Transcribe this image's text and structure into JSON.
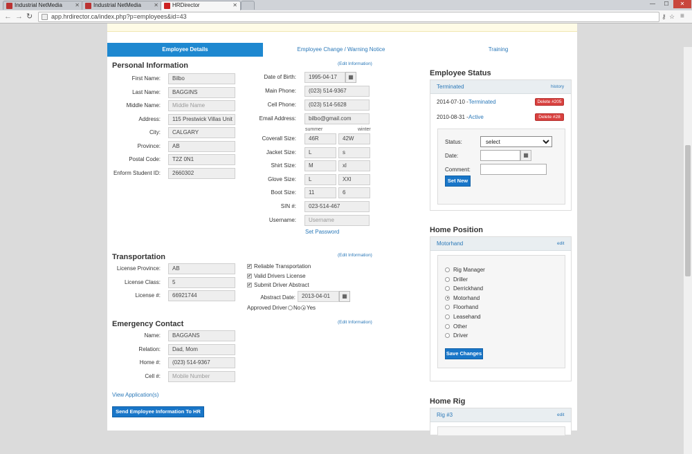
{
  "browser": {
    "tabs": [
      {
        "title": "Industrial NetMedia"
      },
      {
        "title": "Industrial NetMedia"
      },
      {
        "title": "HRDirector"
      }
    ],
    "url": "app.hrdirector.ca/index.php?p=employees&id=43"
  },
  "page_tabs": [
    "Employee Details",
    "Employee Change / Warning Notice",
    "Training"
  ],
  "personal": {
    "title": "Personal Information",
    "edit_link": "(Edit Information)",
    "fields": [
      {
        "label": "First Name:",
        "value": "Bilbo"
      },
      {
        "label": "Last Name:",
        "value": "BAGGINS"
      },
      {
        "label": "Middle Name:",
        "value": "Middle Name"
      },
      {
        "label": "Address:",
        "value": "115 Prestwick Villas Unit"
      },
      {
        "label": "City:",
        "value": "CALGARY"
      },
      {
        "label": "Province:",
        "value": "AB"
      },
      {
        "label": "Postal Code:",
        "value": "T2Z 0N1"
      },
      {
        "label": "Enform Student ID:",
        "value": "2660302"
      }
    ],
    "right_fields": [
      {
        "label": "Date of Birth:",
        "value": "1995-04-17"
      },
      {
        "label": "Main Phone:",
        "value": "(023) 514-9367"
      },
      {
        "label": "Cell Phone:",
        "value": "(023) 514-5628"
      },
      {
        "label": "Email Address:",
        "value": "bilbo@gmail.com"
      }
    ],
    "season_headers": [
      "summer",
      "winter"
    ],
    "sizes": [
      {
        "label": "Coverall Size:",
        "summer": "46R",
        "winter": "42W"
      },
      {
        "label": "Jacket Size:",
        "summer": "L",
        "winter": "s"
      },
      {
        "label": "Shirt Size:",
        "summer": "M",
        "winter": "xl"
      },
      {
        "label": "Glove Size:",
        "summer": "L",
        "winter": "XXl"
      },
      {
        "label": "Boot Size:",
        "summer": "11",
        "winter": "6"
      }
    ],
    "sin_label": "SIN #:",
    "sin_value": "023-514-467",
    "username_label": "Username:",
    "username_placeholder": "Username",
    "set_password": "Set Password"
  },
  "transportation": {
    "title": "Transportation",
    "edit_link": "(Edit Information)",
    "fields": [
      {
        "label": "License Province:",
        "value": "AB"
      },
      {
        "label": "License Class:",
        "value": "5"
      },
      {
        "label": "License #:",
        "value": "66921744"
      }
    ],
    "checks": [
      "Reliable Transportation",
      "Valid Drivers License",
      "Submit Driver Abstract"
    ],
    "abstract_label": "Abstract Date:",
    "abstract_value": "2013-04-01",
    "approved_label": "Approved Driver",
    "no_label": "No",
    "yes_label": "Yes"
  },
  "emergency": {
    "title": "Emergency Contact",
    "edit_link": "(Edit Information)",
    "fields": [
      {
        "label": "Name:",
        "value": "BAGGANS"
      },
      {
        "label": "Relation:",
        "value": "Dad, Mom"
      },
      {
        "label": "Home #:",
        "value": "(023) 514-9367"
      },
      {
        "label": "Cell #:",
        "value": "Mobile Number"
      }
    ]
  },
  "view_applications": "View Application(s)",
  "send_button": "Send Employee Information To HR",
  "status": {
    "title": "Employee Status",
    "current": "Terminated",
    "history": "history",
    "entries": [
      {
        "date": "2014-07-10 - ",
        "state": "Terminated",
        "button": "Delete #205"
      },
      {
        "date": "2010-08-31 - ",
        "state": "Active",
        "button": "Delete #28"
      }
    ],
    "status_label": "Status:",
    "status_select": "select",
    "date_label": "Date:",
    "comment_label": "Comment:",
    "set_new": "Set New"
  },
  "home_position": {
    "title": "Home Position",
    "current": "Motorhand",
    "edit": "edit",
    "options": [
      "Rig Manager",
      "Driller",
      "Derrickhand",
      "Motorhand",
      "Floorhand",
      "Leasehand",
      "Other",
      "Driver"
    ],
    "selected": "Motorhand",
    "save": "Save Changes"
  },
  "home_rig": {
    "title": "Home Rig",
    "current": "Rig #3",
    "edit": "edit"
  },
  "icons": {
    "calendar": "calendar-icon",
    "checkbox": "checkmark-icon"
  }
}
